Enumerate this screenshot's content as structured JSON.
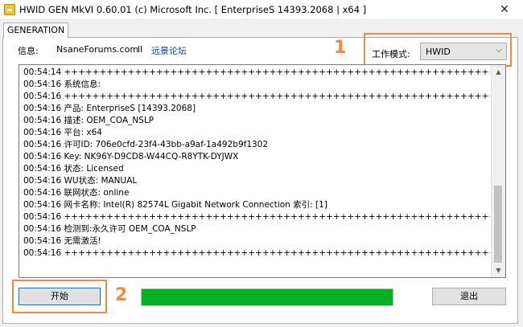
{
  "window": {
    "title": "HWID GEN MkVI 0.60.01 (c) Microsoft Inc. [ EnterpriseS 14393.2068 | x64 ]",
    "close_glyph": "✕"
  },
  "tabs": [
    {
      "label": "GENERATION",
      "selected": true
    }
  ],
  "info": {
    "label": "信息:",
    "site": "NsaneForums.com",
    "separator": "ll",
    "link": "远景论坛"
  },
  "mode": {
    "label": "工作模式:",
    "value": "HWID",
    "caret": "⌵"
  },
  "annotations": {
    "step1": "1",
    "step2": "2",
    "color": "#f08a3c"
  },
  "log": {
    "lines": [
      "00:54:14 ++++++++++++++++++++++++++++++++++++++++++++++++++++++++++++++++++++",
      "00:54:16 系统信息:",
      "00:54:16 ++++++++++++++++++++++++++++++++++++++++++++++++++++++++++++++++++++",
      "00:54:16 产品: EnterpriseS [14393.2068]",
      "00:54:16 描述: OEM_COA_NSLP",
      "00:54:16 平台: x64",
      "00:54:16 许可ID: 706e0cfd-23f4-43bb-a9af-1a492b9f1302",
      "00:54:16 Key: NK96Y-D9CD8-W44CQ-R8YTK-DYJWX",
      "00:54:16 状态: Licensed",
      "00:54:16 WU状态: MANUAL",
      "00:54:16 联网状态: online",
      "00:54:16 网卡名称: Intel(R) 82574L Gigabit Network Connection 索引: [1]",
      "00:54:16 ++++++++++++++++++++++++++++++++++++++++++++++++++++++++++++++++++++",
      "00:54:16 检测到:永久许可 OEM_COA_NSLP",
      "00:54:16 无需激活!",
      "00:54:16 ++++++++++++++++++++++++++++++++++++++++++++++++++++++++++++++++++++|"
    ],
    "scroll_up_glyph": "▲",
    "scroll_down_glyph": "▼"
  },
  "buttons": {
    "start": "开始",
    "exit": "退出"
  },
  "progress": {
    "value": 1.0,
    "color": "#06b025"
  }
}
